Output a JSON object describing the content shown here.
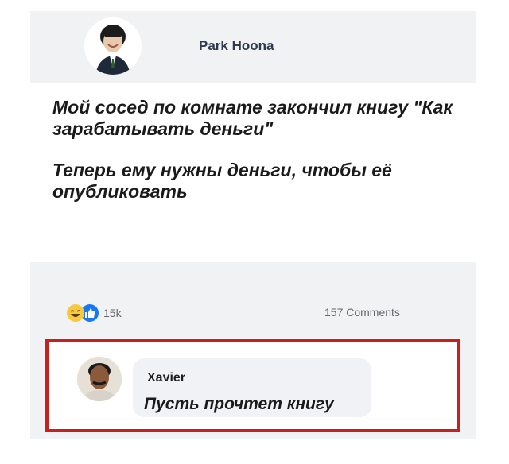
{
  "post": {
    "author": "Park Hoona",
    "lines": [
      "Мой сосед по комнате закончил книгу \"Как зарабатывать деньги\"",
      "Теперь ему нужны деньги, чтобы её опубликовать"
    ]
  },
  "reactions": {
    "icons": [
      "haha-icon",
      "like-icon"
    ],
    "count": "15k",
    "comments": "157 Comments"
  },
  "comment": {
    "author": "Xavier",
    "text": "Пусть прочтет книгу"
  },
  "colors": {
    "highlight_border": "#c81f1f",
    "like": "#1877f2",
    "haha": "#f7c943"
  }
}
